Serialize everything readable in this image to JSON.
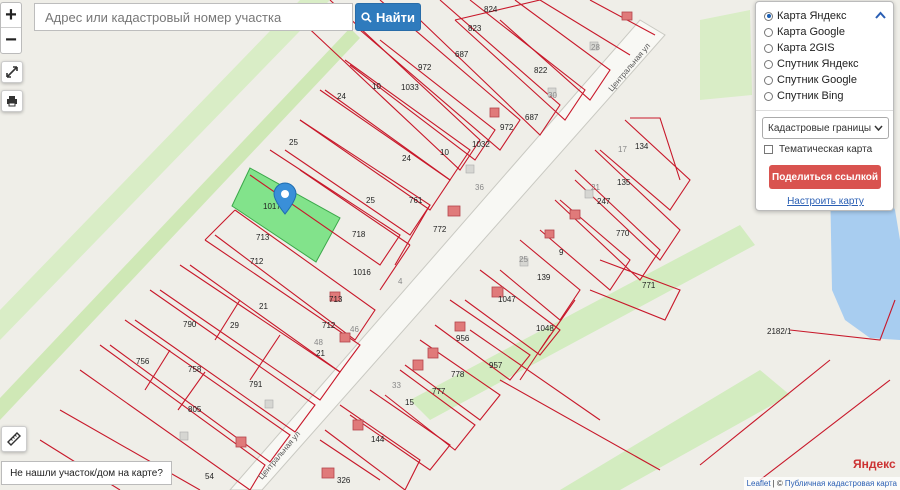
{
  "search": {
    "placeholder": "Адрес или кадастровый номер участка",
    "button_label": "Найти"
  },
  "zoom": {
    "in_label": "+",
    "out_label": "−"
  },
  "layers_panel": {
    "base_layers": [
      {
        "label": "Карта Яндекс",
        "selected": true
      },
      {
        "label": "Карта Google",
        "selected": false
      },
      {
        "label": "Карта 2GIS",
        "selected": false
      },
      {
        "label": "Спутник Яндекс",
        "selected": false
      },
      {
        "label": "Спутник Google",
        "selected": false
      },
      {
        "label": "Спутник Bing",
        "selected": false
      }
    ],
    "overlay_select": "Кадастровые границы",
    "thematic_label": "Тематическая карта",
    "share_label": "Поделиться ссылкой",
    "restore_label": "Настроить карту"
  },
  "not_found_label": "Не нашли участок/дом на карте?",
  "attribution": {
    "leaflet": "Leaflet",
    "separator": " | © ",
    "source": "Публичная кадастровая карта"
  },
  "map_logo": "Яндекс",
  "streets": [
    {
      "label": "Центральная ул"
    },
    {
      "label": "Центральная ул"
    }
  ],
  "parcels": [
    {
      "label": "824"
    },
    {
      "label": "823"
    },
    {
      "label": "687"
    },
    {
      "label": "972"
    },
    {
      "label": "822"
    },
    {
      "label": "24"
    },
    {
      "label": "10"
    },
    {
      "label": "1033"
    },
    {
      "label": "972"
    },
    {
      "label": "687"
    },
    {
      "label": "25"
    },
    {
      "label": "24"
    },
    {
      "label": "10"
    },
    {
      "label": "1032"
    },
    {
      "label": "1017"
    },
    {
      "label": "25"
    },
    {
      "label": "761"
    },
    {
      "label": "713"
    },
    {
      "label": "718"
    },
    {
      "label": "772"
    },
    {
      "label": "712"
    },
    {
      "label": "1016"
    },
    {
      "label": "21"
    },
    {
      "label": "713"
    },
    {
      "label": "790"
    },
    {
      "label": "29"
    },
    {
      "label": "712"
    },
    {
      "label": "21"
    },
    {
      "label": "756"
    },
    {
      "label": "758"
    },
    {
      "label": "791"
    },
    {
      "label": "805"
    },
    {
      "label": "54"
    },
    {
      "label": "134"
    },
    {
      "label": "135"
    },
    {
      "label": "247"
    },
    {
      "label": "770"
    },
    {
      "label": "9"
    },
    {
      "label": "139"
    },
    {
      "label": "771"
    },
    {
      "label": "1047"
    },
    {
      "label": "1048"
    },
    {
      "label": "956"
    },
    {
      "label": "957"
    },
    {
      "label": "778"
    },
    {
      "label": "777"
    },
    {
      "label": "15"
    },
    {
      "label": "144"
    },
    {
      "label": "326"
    },
    {
      "label": "2182/1"
    },
    {
      "label": "48"
    },
    {
      "label": "28"
    },
    {
      "label": "30"
    },
    {
      "label": "36"
    },
    {
      "label": "46"
    },
    {
      "label": "33"
    },
    {
      "label": "21"
    },
    {
      "label": "17"
    },
    {
      "label": "25"
    },
    {
      "label": "4"
    }
  ]
}
